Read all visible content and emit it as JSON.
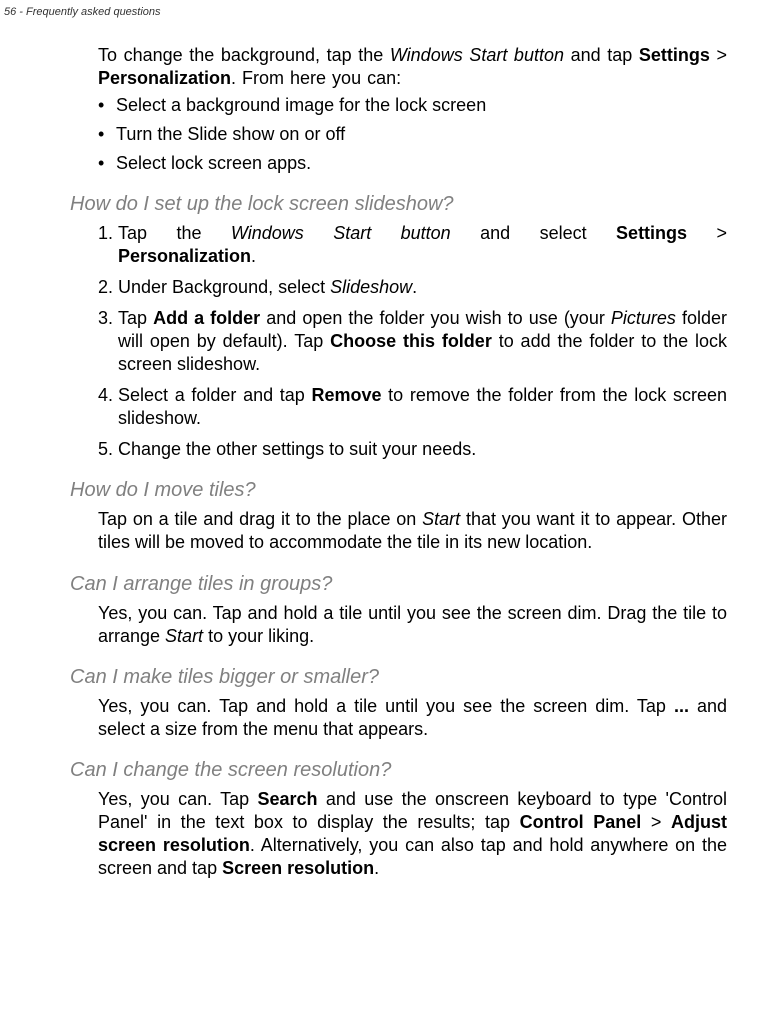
{
  "header": {
    "page": "56 - Frequently asked questions"
  },
  "intro": {
    "line": "To change the background, tap the <span class=\"it\">Windows Start button</span> and tap <span class=\"b\">Settings</span> > <span class=\"b\">Personalization</span>. From here you can:",
    "bullets": [
      "Select a background image for the lock screen",
      "Turn the <span class=\"it\">Slide show</span> on or off",
      "Select lock screen apps."
    ]
  },
  "sec1": {
    "title": "How do I set up the lock screen slideshow?",
    "items": [
      "Tap the <span class=\"it\">Windows Start button</span> and select <span class=\"b\">Settings</span> > <span class=\"b\">Personalization</span>.",
      "Under Background, select <span class=\"it\">Slideshow</span>.",
      "Tap <span class=\"b\">Add a folder</span> and open the folder you wish to use (your <span class=\"it\">Pictures</span> folder will open by default). Tap <span class=\"b\">Choose this folder</span> to add the folder to the lock screen slideshow.",
      "Select a folder and tap <span class=\"b\">Remove</span> to remove the folder from the lock screen slideshow.",
      "Change the other settings to suit your needs."
    ]
  },
  "sec2": {
    "title": "How do I move tiles?",
    "body": "Tap on a tile and drag it to the place on <span class=\"it\">Start</span> that you want it to appear. Other tiles will be moved to accommodate the tile in its new location."
  },
  "sec3": {
    "title": "Can I arrange tiles in groups?",
    "body": "Yes, you can. Tap and hold a tile until you see the screen dim. Drag the tile to arrange <span class=\"it\">Start</span> to your liking."
  },
  "sec4": {
    "title": "Can I make tiles bigger or smaller?",
    "body": "Yes, you can. Tap and hold a tile until you see the screen dim. Tap <span class=\"b\">...</span> and select a size from the menu that appears."
  },
  "sec5": {
    "title": "Can I change the screen resolution?",
    "body": "Yes, you can. Tap <span class=\"b\">Search</span> and use the onscreen keyboard to type 'Control Panel' in the text box to display the results; tap <span class=\"b\">Control Panel</span> > <span class=\"b\">Adjust screen resolution</span>. Alternatively, you can also tap and hold anywhere on the screen and tap <span class=\"b\">Screen resolution</span>."
  }
}
